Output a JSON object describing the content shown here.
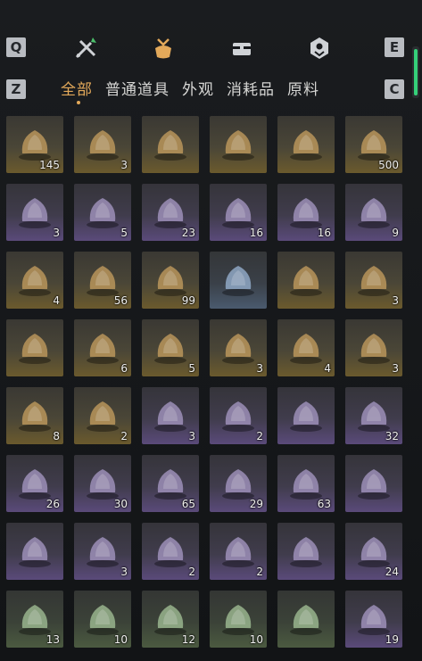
{
  "keys": {
    "prev_cat": "Q",
    "next_cat": "E",
    "prev_tab": "Z",
    "next_tab": "C"
  },
  "categories": [
    {
      "name": "weapon-category-icon"
    },
    {
      "name": "bag-category-icon"
    },
    {
      "name": "chest-category-icon"
    },
    {
      "name": "gem-category-icon"
    }
  ],
  "tabs": [
    "全部",
    "普通道具",
    "外观",
    "消耗品",
    "原料"
  ],
  "active_tab": 0,
  "colors": {
    "accent": "#e3a95a",
    "scroll": "#35d07a"
  },
  "items": [
    {
      "icon": "wine-jars-icon",
      "count": "145",
      "rarity": "gold"
    },
    {
      "icon": "chopsticks-cloth-icon",
      "count": "3",
      "rarity": "gold"
    },
    {
      "icon": "porcelain-vase-icon",
      "count": "",
      "rarity": "gold"
    },
    {
      "icon": "red-book-icon",
      "count": "",
      "rarity": "gold"
    },
    {
      "icon": "open-book-icon",
      "count": "",
      "rarity": "gold"
    },
    {
      "icon": "jade-ring-icon",
      "count": "500",
      "rarity": "gold"
    },
    {
      "icon": "dark-chest-icon",
      "count": "3",
      "rarity": "purple"
    },
    {
      "icon": "carved-chest-icon",
      "count": "5",
      "rarity": "purple"
    },
    {
      "icon": "dark-chest-icon",
      "count": "23",
      "rarity": "purple"
    },
    {
      "icon": "ornate-chest-icon",
      "count": "16",
      "rarity": "purple"
    },
    {
      "icon": "iron-chest-icon",
      "count": "16",
      "rarity": "purple"
    },
    {
      "icon": "jade-ore-icon",
      "count": "9",
      "rarity": "purple"
    },
    {
      "icon": "scroll-plaque-icon",
      "count": "4",
      "rarity": "gold"
    },
    {
      "icon": "bird-token-icon",
      "count": "56",
      "rarity": "gold"
    },
    {
      "icon": "bird-token-icon",
      "count": "99",
      "rarity": "gold"
    },
    {
      "icon": "green-fruit-icon",
      "count": "",
      "rarity": "blue"
    },
    {
      "icon": "gold-ore-icon",
      "count": "",
      "rarity": "gold"
    },
    {
      "icon": "carved-stone-icon",
      "count": "3",
      "rarity": "gold"
    },
    {
      "icon": "marble-stone-icon",
      "count": "",
      "rarity": "gold"
    },
    {
      "icon": "blue-flower-icon",
      "count": "6",
      "rarity": "gold"
    },
    {
      "icon": "rat-icon",
      "count": "5",
      "rarity": "gold"
    },
    {
      "icon": "petal-twig-icon",
      "count": "3",
      "rarity": "gold"
    },
    {
      "icon": "golden-toad-icon",
      "count": "4",
      "rarity": "gold"
    },
    {
      "icon": "pinecone-stone-icon",
      "count": "3",
      "rarity": "gold"
    },
    {
      "icon": "cricket-icon",
      "count": "8",
      "rarity": "gold"
    },
    {
      "icon": "insects-icon",
      "count": "2",
      "rarity": "gold"
    },
    {
      "icon": "purple-moth-icon",
      "count": "3",
      "rarity": "purple"
    },
    {
      "icon": "purple-herb-icon",
      "count": "2",
      "rarity": "purple"
    },
    {
      "icon": "silver-hairpin-icon",
      "count": "",
      "rarity": "purple"
    },
    {
      "icon": "rice-balls-icon",
      "count": "32",
      "rarity": "purple"
    },
    {
      "icon": "porridge-bowl-icon",
      "count": "26",
      "rarity": "purple"
    },
    {
      "icon": "egg-soup-icon",
      "count": "30",
      "rarity": "purple"
    },
    {
      "icon": "braised-dish-icon",
      "count": "65",
      "rarity": "purple"
    },
    {
      "icon": "fried-dish-icon",
      "count": "29",
      "rarity": "purple"
    },
    {
      "icon": "meat-bowl-icon",
      "count": "63",
      "rarity": "purple"
    },
    {
      "icon": "recipe-paper-icon",
      "count": "",
      "rarity": "purple"
    },
    {
      "icon": "recipe-paper-icon",
      "count": "",
      "rarity": "purple"
    },
    {
      "icon": "egg-plate-icon",
      "count": "3",
      "rarity": "purple"
    },
    {
      "icon": "fish-plate-icon",
      "count": "2",
      "rarity": "purple"
    },
    {
      "icon": "cucumber-plate-icon",
      "count": "2",
      "rarity": "purple"
    },
    {
      "icon": "roast-meat-icon",
      "count": "",
      "rarity": "purple"
    },
    {
      "icon": "stew-pot-icon",
      "count": "24",
      "rarity": "purple"
    },
    {
      "icon": "red-stew-icon",
      "count": "13",
      "rarity": "green"
    },
    {
      "icon": "mountain-token-icon",
      "count": "10",
      "rarity": "green"
    },
    {
      "icon": "black-tablet-icon",
      "count": "12",
      "rarity": "green"
    },
    {
      "icon": "white-peaks-icon",
      "count": "10",
      "rarity": "green"
    },
    {
      "icon": "ink-stick-icon",
      "count": "",
      "rarity": "green"
    },
    {
      "icon": "noodle-bowl-icon",
      "count": "19",
      "rarity": "purple"
    }
  ]
}
